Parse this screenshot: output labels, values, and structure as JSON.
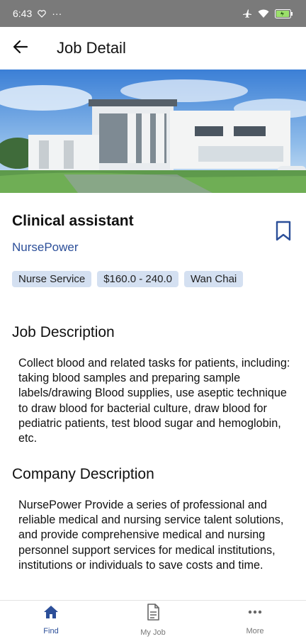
{
  "status_bar": {
    "time": "6:43",
    "dots": "···"
  },
  "header": {
    "title": "Job Detail"
  },
  "job": {
    "title": "Clinical assistant",
    "company": "NursePower",
    "tags": [
      "Nurse Service",
      "$160.0 - 240.0",
      "Wan Chai"
    ]
  },
  "job_description": {
    "title": "Job Description",
    "body": "Collect blood and related tasks for patients, including: taking blood samples and preparing sample labels/drawing Blood supplies, use aseptic technique to draw blood for bacterial culture, draw blood for pediatric patients, test blood sugar and hemoglobin, etc."
  },
  "company_description": {
    "title": "Company Description",
    "body": "NursePower Provide a series of professional and reliable medical and nursing service talent solutions, and provide comprehensive medical and nursing personnel support services for medical institutions, institutions or individuals to save costs and time."
  },
  "bottom_nav": {
    "items": [
      {
        "label": "Find",
        "icon": "home-icon",
        "active": true
      },
      {
        "label": "My Job",
        "icon": "document-icon",
        "active": false
      },
      {
        "label": "More",
        "icon": "more-dots-icon",
        "active": false
      }
    ]
  },
  "colors": {
    "accent": "#2c4f99",
    "tag_bg": "#d4e0f1",
    "status_bar": "#7a7a7a"
  }
}
